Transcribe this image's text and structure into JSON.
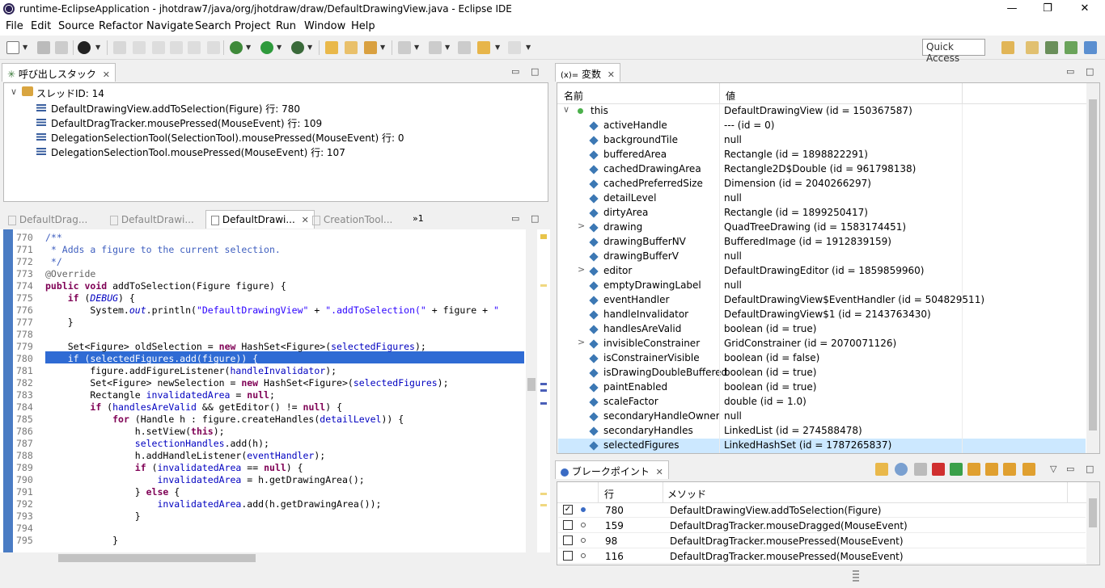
{
  "window": {
    "title": "runtime-EclipseApplication - jhotdraw7/java/org/jhotdraw/draw/DefaultDrawingView.java - Eclipse IDE",
    "minimize": "—",
    "restore": "❐",
    "close": "✕"
  },
  "menu": [
    "File",
    "Edit",
    "Source",
    "Refactor",
    "Navigate",
    "Search",
    "Project",
    "Run",
    "Window",
    "Help"
  ],
  "toolbar": {
    "quick_access": "Quick Access"
  },
  "callstack": {
    "title": "呼び出しスタック",
    "thread": "スレッドID: 14",
    "frames": [
      "DefaultDrawingView.addToSelection(Figure) 行: 780",
      "DefaultDragTracker.mousePressed(MouseEvent) 行: 109",
      "DelegationSelectionTool(SelectionTool).mousePressed(MouseEvent) 行: 0",
      "DelegationSelectionTool.mousePressed(MouseEvent) 行: 107"
    ]
  },
  "editor": {
    "tabs": [
      {
        "label": "DefaultDrag...",
        "active": false
      },
      {
        "label": "DefaultDrawi...",
        "active": false
      },
      {
        "label": "DefaultDrawi...",
        "active": true
      },
      {
        "label": "CreationTool...",
        "active": false
      }
    ],
    "overflow": "»1",
    "line_numbers": [
      "770",
      "771",
      "772",
      "773",
      "774",
      "775",
      "776",
      "777",
      "778",
      "779",
      "780",
      "781",
      "782",
      "783",
      "784",
      "785",
      "786",
      "787",
      "788",
      "789",
      "790",
      "791",
      "792",
      "793",
      "794",
      "795"
    ]
  },
  "variables": {
    "title": "変数",
    "prefix": "(x)=",
    "col_name": "名前",
    "col_value": "値",
    "rows": [
      {
        "name": "this",
        "value": "DefaultDrawingView (id = 150367587)",
        "expand": "∨",
        "kind": "root"
      },
      {
        "name": "activeHandle",
        "value": "--- (id = 0)",
        "expand": ""
      },
      {
        "name": "backgroundTile",
        "value": "null",
        "expand": ""
      },
      {
        "name": "bufferedArea",
        "value": "Rectangle (id = 1898822291)",
        "expand": ""
      },
      {
        "name": "cachedDrawingArea",
        "value": "Rectangle2D$Double (id = 961798138)",
        "expand": ""
      },
      {
        "name": "cachedPreferredSize",
        "value": "Dimension (id = 2040266297)",
        "expand": ""
      },
      {
        "name": "detailLevel",
        "value": "null",
        "expand": ""
      },
      {
        "name": "dirtyArea",
        "value": "Rectangle (id = 1899250417)",
        "expand": ""
      },
      {
        "name": "drawing",
        "value": "QuadTreeDrawing (id = 1583174451)",
        "expand": ">"
      },
      {
        "name": "drawingBufferNV",
        "value": "BufferedImage (id = 1912839159)",
        "expand": ""
      },
      {
        "name": "drawingBufferV",
        "value": "null",
        "expand": ""
      },
      {
        "name": "editor",
        "value": "DefaultDrawingEditor (id = 1859859960)",
        "expand": ">"
      },
      {
        "name": "emptyDrawingLabel",
        "value": "null",
        "expand": ""
      },
      {
        "name": "eventHandler",
        "value": "DefaultDrawingView$EventHandler (id = 504829511)",
        "expand": ""
      },
      {
        "name": "handleInvalidator",
        "value": "DefaultDrawingView$1 (id = 2143763430)",
        "expand": ""
      },
      {
        "name": "handlesAreValid",
        "value": "boolean (id = true)",
        "expand": ""
      },
      {
        "name": "invisibleConstrainer",
        "value": "GridConstrainer (id = 2070071126)",
        "expand": ">"
      },
      {
        "name": "isConstrainerVisible",
        "value": "boolean (id = false)",
        "expand": ""
      },
      {
        "name": "isDrawingDoubleBuffered",
        "value": "boolean (id = true)",
        "expand": ""
      },
      {
        "name": "paintEnabled",
        "value": "boolean (id = true)",
        "expand": ""
      },
      {
        "name": "scaleFactor",
        "value": "double (id = 1.0)",
        "expand": ""
      },
      {
        "name": "secondaryHandleOwner",
        "value": "null",
        "expand": ""
      },
      {
        "name": "secondaryHandles",
        "value": "LinkedList (id = 274588478)",
        "expand": ""
      },
      {
        "name": "selectedFigures",
        "value": "LinkedHashSet (id = 1787265837)",
        "expand": "",
        "selected": true
      }
    ]
  },
  "breakpoints": {
    "title": "ブレークポイント",
    "col_line": "行",
    "col_method": "メソッド",
    "rows": [
      {
        "checked": true,
        "line": "780",
        "method": "DefaultDrawingView.addToSelection(Figure)"
      },
      {
        "checked": false,
        "line": "159",
        "method": "DefaultDragTracker.mouseDragged(MouseEvent)"
      },
      {
        "checked": false,
        "line": "98",
        "method": "DefaultDragTracker.mousePressed(MouseEvent)"
      },
      {
        "checked": false,
        "line": "116",
        "method": "DefaultDragTracker.mousePressed(MouseEvent)"
      }
    ]
  },
  "colors": {
    "accent": "#2f6bd4",
    "keyword": "#7f0055",
    "comment": "#3f5fbf",
    "field": "#0000c0"
  }
}
